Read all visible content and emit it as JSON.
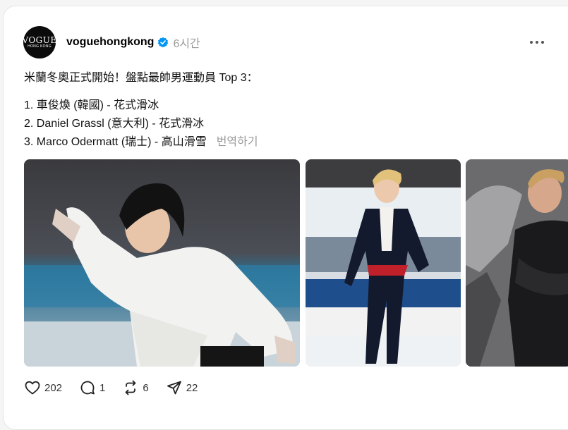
{
  "post": {
    "username": "voguehongkong",
    "timestamp": "6시간",
    "avatar": {
      "logo_text": "VOGUE",
      "logo_sub": "HONG KONG"
    },
    "text_line1": "米蘭冬奧正式開始！盤點最帥男運動員 Top 3：",
    "text_line2": "1. 車俊煥 (韓國) - 花式滑冰",
    "text_line3": "2. Daniel Grassl (意大利) - 花式滑冰",
    "text_line4": "3. Marco Odermatt (瑞士) - 高山滑雪",
    "translate_label": "번역하기"
  },
  "actions": {
    "likes": "202",
    "replies": "1",
    "reposts": "6",
    "shares": "22"
  },
  "colors": {
    "verified_blue": "#0095f6",
    "muted_text": "#999999",
    "card_bg": "#ffffff"
  },
  "icons": [
    "verified-badge-icon",
    "more-icon",
    "heart-icon",
    "comment-icon",
    "repost-icon",
    "share-icon"
  ]
}
